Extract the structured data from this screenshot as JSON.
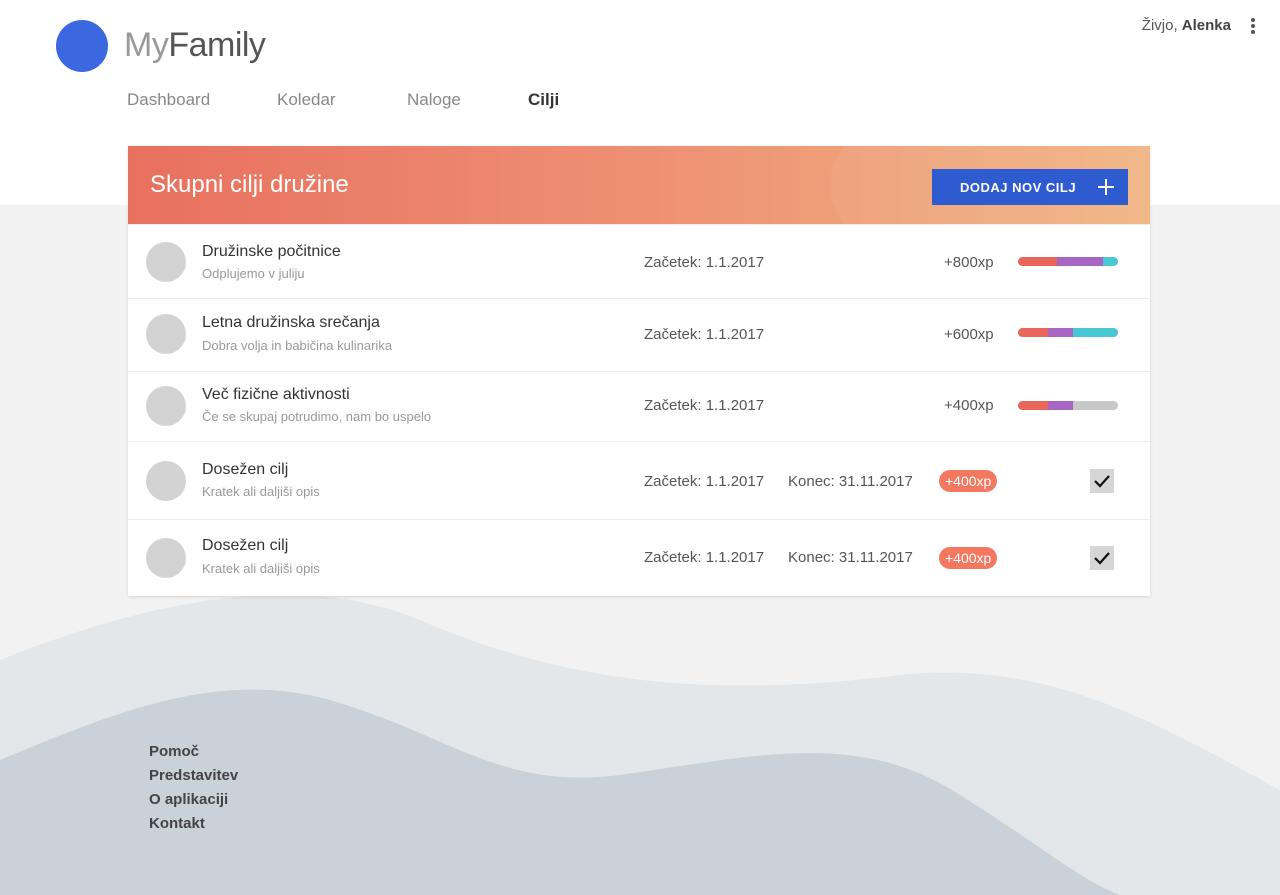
{
  "app": {
    "brand_prefix": "My",
    "brand_suffix": "Family"
  },
  "user": {
    "greeting": "Živjo,",
    "name": "Alenka"
  },
  "nav": [
    {
      "label": "Dashboard",
      "active": false
    },
    {
      "label": "Koledar",
      "active": false
    },
    {
      "label": "Naloge",
      "active": false
    },
    {
      "label": "Cilji",
      "active": true
    }
  ],
  "card": {
    "title": "Skupni cilji družine",
    "add_label": "DODAJ NOV CILJ"
  },
  "colors": {
    "accent_blue": "#2f5bd1",
    "logo": "#3b67e0",
    "seg_red": "#e8665a",
    "seg_purple": "#a866c2",
    "seg_cyan": "#4ac7d4",
    "seg_empty": "#c8c8c8",
    "badge": "#f4775f"
  },
  "goals": [
    {
      "title": "Družinske počitnice",
      "subtitle": "Odplujemo v juliju",
      "start": "Začetek: 1.1.2017",
      "xp": "+800xp",
      "progress": [
        {
          "value": 0.39,
          "color": "#e8665a"
        },
        {
          "value": 0.46,
          "color": "#a866c2"
        },
        {
          "value": 0.15,
          "color": "#4ac7d4"
        }
      ]
    },
    {
      "title": "Letna družinska srečanja",
      "subtitle": "Dobra volja in babičina kulinarika",
      "start": "Začetek: 1.1.2017",
      "xp": "+600xp",
      "progress": [
        {
          "value": 0.3,
          "color": "#e8665a"
        },
        {
          "value": 0.25,
          "color": "#a866c2"
        },
        {
          "value": 0.45,
          "color": "#4ac7d4"
        }
      ]
    },
    {
      "title": "Več fizične aktivnosti",
      "subtitle": "Če se skupaj potrudimo, nam bo uspelo",
      "start": "Začetek: 1.1.2017",
      "xp": "+400xp",
      "progress": [
        {
          "value": 0.3,
          "color": "#e8665a"
        },
        {
          "value": 0.25,
          "color": "#a866c2"
        }
      ]
    }
  ],
  "achieved": [
    {
      "title": "Dosežen cilj",
      "subtitle": "Kratek ali daljiši opis",
      "start": "Začetek: 1.1.2017",
      "end": "Konec: 31.11.2017",
      "xp": "+400xp",
      "checked": true
    },
    {
      "title": "Dosežen cilj",
      "subtitle": "Kratek ali daljiši opis",
      "start": "Začetek: 1.1.2017",
      "end": "Konec: 31.11.2017",
      "xp": "+400xp",
      "checked": true
    }
  ],
  "footer": {
    "links": [
      "Pomoč",
      "Predstavitev",
      "O aplikaciji",
      "Kontakt"
    ]
  }
}
